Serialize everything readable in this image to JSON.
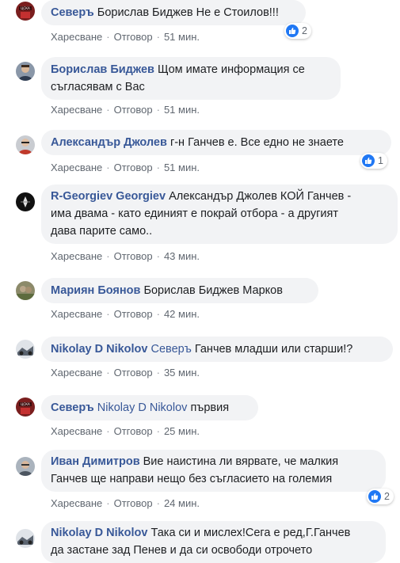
{
  "colors": {
    "author": "#385898",
    "bubble": "#f2f3f5",
    "meta": "#606770",
    "like_blue": "#2078f4"
  },
  "actions": {
    "like": "Харесване",
    "reply": "Отговор",
    "separator": "·"
  },
  "comments": [
    {
      "author": "Северъ",
      "lines": [
        "Борислав Биджев Не е Стоилов!!!"
      ],
      "time": "51 мин.",
      "reactions": {
        "icon": "like-icon",
        "count": "2"
      }
    },
    {
      "author": "Борислав Биджев",
      "lines": [
        "Щом имате информация се",
        "съгласявам с Вас"
      ],
      "time": "51 мин."
    },
    {
      "author": "Александър Джолев",
      "lines": [
        "г-н Ганчев е. Все едно не знаете"
      ],
      "time": "51 мин.",
      "reactions": {
        "icon": "like-icon",
        "count": "1"
      }
    },
    {
      "author": "R-Georgiev Georgiev",
      "lines": [
        "Александър Джолев КОЙ Ганчев -",
        "има двама - като единият е покрай отбора - а другият",
        "дава парите само.."
      ],
      "time": "43 мин."
    },
    {
      "author": "Мариян Боянов",
      "lines": [
        "Борислав Биджев Марков"
      ],
      "time": "42 мин."
    },
    {
      "author": "Nikolay D Nikolov",
      "mention": "Северъ",
      "lines": [
        "Ганчев младши или старши!?"
      ],
      "time": "35 мин."
    },
    {
      "author": "Северъ",
      "mention": "Nikolay D Nikolov",
      "lines": [
        "първия"
      ],
      "time": "25 мин."
    },
    {
      "author": "Иван Димитров",
      "lines": [
        "Вие наистина ли вярвате, че малкия",
        "Ганчев ще направи нещо без съгласието на големия"
      ],
      "time": "24 мин.",
      "reactions": {
        "icon": "like-icon",
        "count": "2"
      }
    },
    {
      "author": "Nikolay D Nikolov",
      "lines": [
        "Така си и мислех!Сега е ред,Г.Ганчев",
        "да застане зад Пенев и да си освободи отрочето"
      ]
    }
  ]
}
